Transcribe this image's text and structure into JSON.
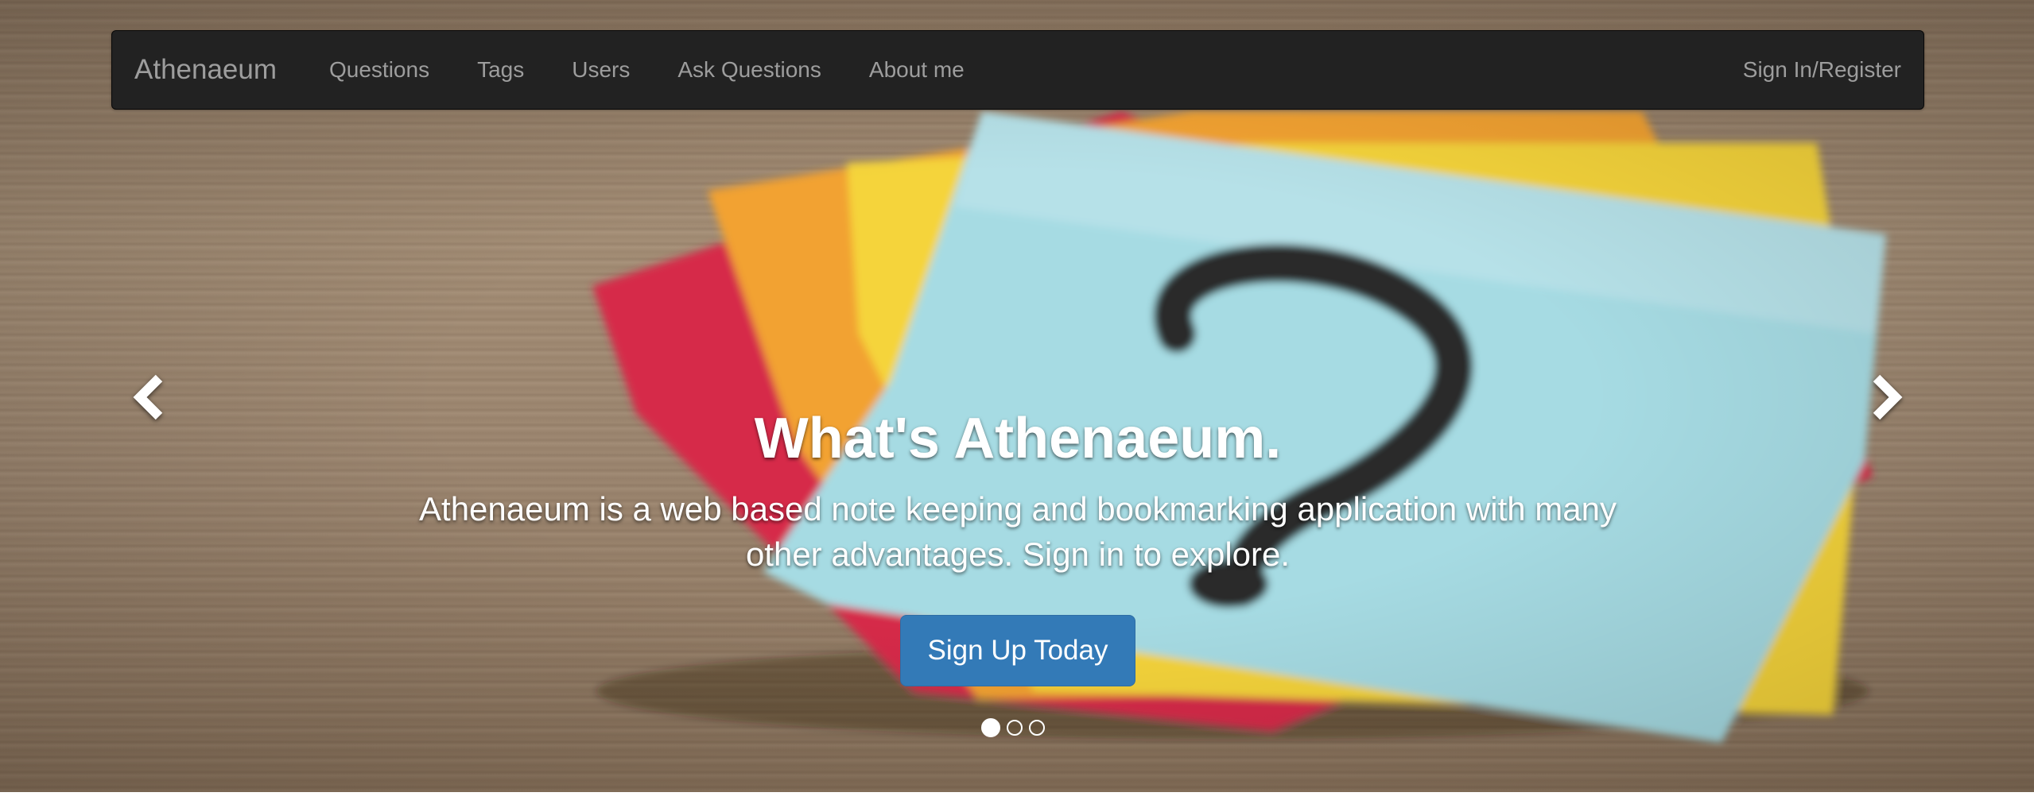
{
  "navbar": {
    "brand": "Athenaeum",
    "links": [
      "Questions",
      "Tags",
      "Users",
      "Ask Questions",
      "About me"
    ],
    "right_link": "Sign In/Register"
  },
  "carousel": {
    "prev_icon": "chevron-left-icon",
    "next_icon": "chevron-right-icon",
    "slide": {
      "heading": "What's Athenaeum.",
      "text": "Athenaeum is a web based note keeping and bookmarking application with many other advantages. Sign in to explore.",
      "button_label": "Sign Up Today"
    },
    "indicator_count": 3,
    "active_indicator": 1
  },
  "colors": {
    "navbar_bg": "#222222",
    "nav_text": "#9d9d9d",
    "primary_button": "#337ab7"
  }
}
